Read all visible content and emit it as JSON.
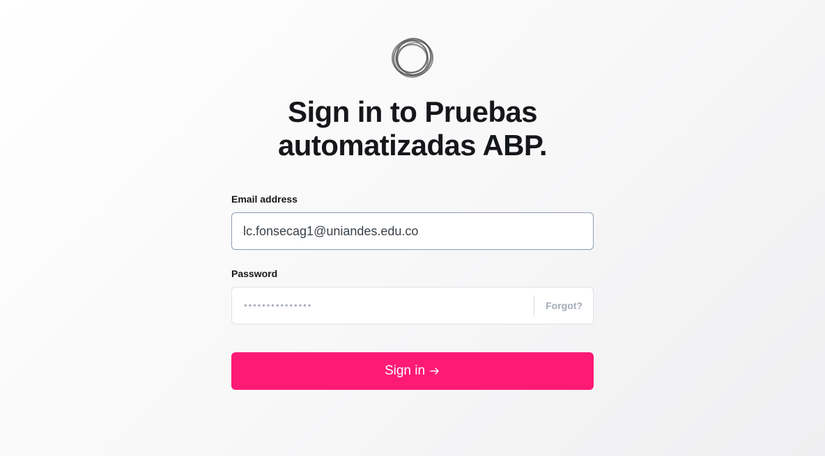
{
  "header": {
    "logo_icon": "ghost-ring-logo-icon",
    "title": "Sign in to Pruebas automatizadas ABP."
  },
  "form": {
    "email": {
      "label": "Email address",
      "value": "lc.fonsecag1@uniandes.edu.co"
    },
    "password": {
      "label": "Password",
      "masked_value": "•••••••••••••••",
      "forgot_label": "Forgot?"
    },
    "submit": {
      "label": "Sign in",
      "icon": "arrow-right-icon"
    }
  },
  "colors": {
    "accent": "#ff1a75",
    "text": "#15171a",
    "muted": "#a4abb6",
    "focus_border": "#8e9cb3"
  }
}
